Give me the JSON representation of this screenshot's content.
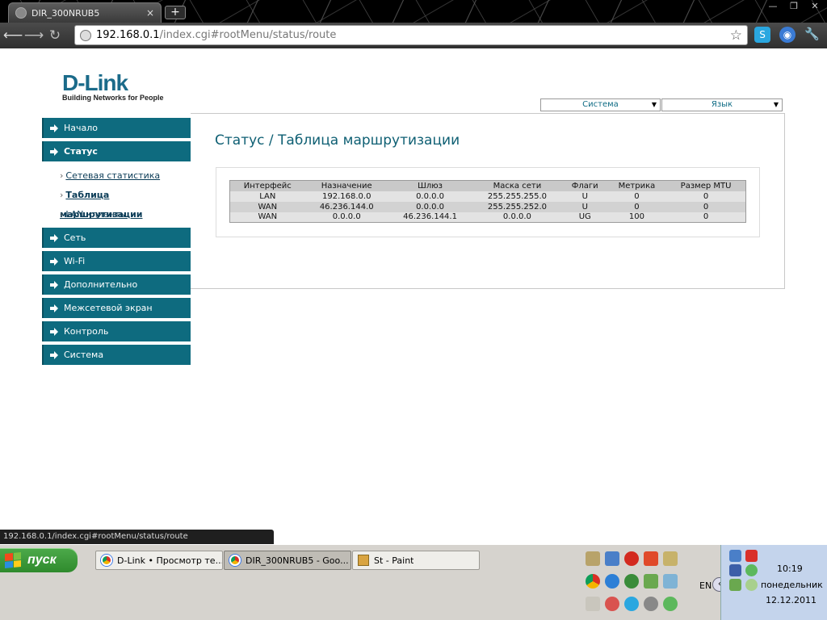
{
  "browser": {
    "tab_title": "DIR_300NRUB5",
    "tab_close": "×",
    "new_tab": "+",
    "window_controls": [
      "—",
      "❐",
      "✕"
    ],
    "url_host": "192.168.0.1",
    "url_path": "/index.cgi#rootMenu/status/route",
    "status_url": "192.168.0.1/index.cgi#rootMenu/status/route"
  },
  "header": {
    "logo_text": "D-Link",
    "logo_tagline": "Building Networks for People",
    "system_select": "Система",
    "language_select": "Язык"
  },
  "page_title": "Статус  / Таблица маршрутизации",
  "sidebar": {
    "items": [
      {
        "label": "Начало"
      },
      {
        "label": "Статус"
      },
      {
        "label": "Сеть"
      },
      {
        "label": "Wi-Fi"
      },
      {
        "label": "Дополнительно"
      },
      {
        "label": "Межсетевой экран"
      },
      {
        "label": "Контроль"
      },
      {
        "label": "Система"
      }
    ],
    "status_sub": [
      {
        "label": "Сетевая статистика"
      },
      {
        "label": "Таблица маршрутизации"
      },
      {
        "label": "LAN клиенты"
      }
    ]
  },
  "route_table": {
    "headers": [
      "Интерфейс",
      "Назначение",
      "Шлюз",
      "Маска сети",
      "Флаги",
      "Метрика",
      "Размер MTU"
    ],
    "rows": [
      [
        "LAN",
        "192.168.0.0",
        "0.0.0.0",
        "255.255.255.0",
        "U",
        "0",
        "0"
      ],
      [
        "WAN",
        "46.236.144.0",
        "0.0.0.0",
        "255.255.252.0",
        "U",
        "0",
        "0"
      ],
      [
        "WAN",
        "0.0.0.0",
        "46.236.144.1",
        "0.0.0.0",
        "UG",
        "100",
        "0"
      ]
    ]
  },
  "taskbar": {
    "start_label": "пуск",
    "tasks": [
      {
        "label": "D-Link • Просмотр те..."
      },
      {
        "label": "DIR_300NRUB5 - Goo..."
      },
      {
        "label": "St - Paint"
      }
    ],
    "lang": "EN",
    "time": "10:19",
    "day": "понедельник",
    "date": "12.12.2011"
  },
  "colors": {
    "brand": "#0e6b7f",
    "title": "#0e5f73"
  }
}
